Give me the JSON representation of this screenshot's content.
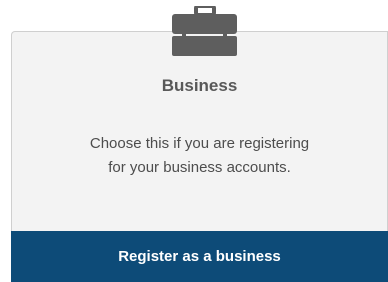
{
  "card": {
    "icon": "briefcase-icon",
    "title": "Business",
    "description_line1": "Choose this if you are registering",
    "description_line2": "for your business accounts.",
    "button_label": "Register as a business"
  },
  "colors": {
    "card_background": "#f3f3f3",
    "icon": "#5e5e5e",
    "button_background": "#0d4b78",
    "button_text": "#ffffff"
  }
}
